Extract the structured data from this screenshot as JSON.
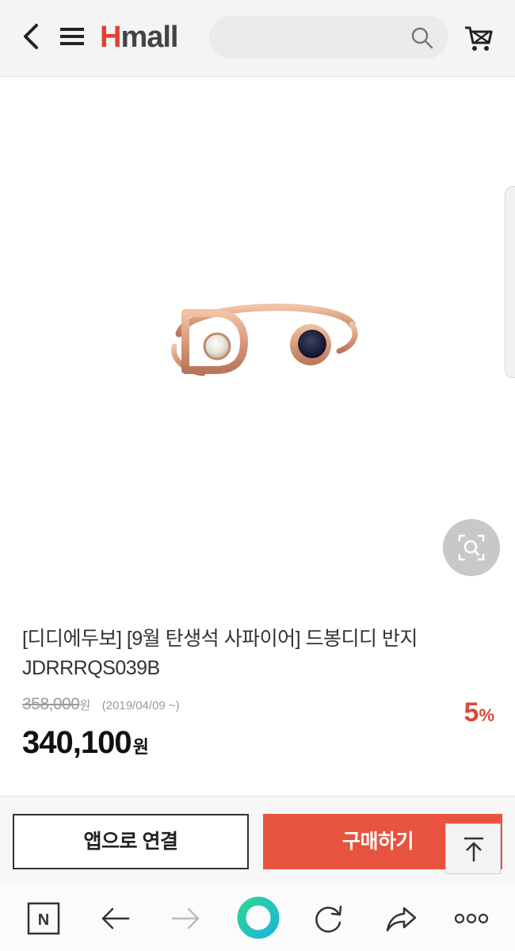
{
  "header": {
    "logo_h": "H",
    "logo_rest": "mall"
  },
  "product": {
    "title_line1": "[디디에두보] [9월 탄생석 사파이어] 드봉디디 반지",
    "title_line2": "JDRRRQS039B",
    "original_price": "358,000",
    "original_currency": "원",
    "price_date": "(2019/04/09 ~)",
    "discount_value": "5",
    "discount_unit": "%",
    "sale_price": "340,100",
    "sale_currency": "원"
  },
  "actions": {
    "app_connect_label": "앱으로 연결",
    "buy_label": "구매하기"
  },
  "browser_nav": {
    "n_label": "N"
  },
  "colors": {
    "brand_red": "#e2412f",
    "buy_button": "#e8533f",
    "discount": "#d9493a",
    "rose_gold": "#d99a7a",
    "sapphire": "#1c1f3a"
  },
  "icons": [
    "back-arrow-icon",
    "hamburger-menu-icon",
    "search-icon",
    "cart-icon",
    "zoom-icon",
    "arrow-up-icon",
    "naver-n-icon",
    "browser-back-icon",
    "browser-forward-icon",
    "home-ring-icon",
    "refresh-icon",
    "share-icon",
    "more-dots-icon"
  ]
}
